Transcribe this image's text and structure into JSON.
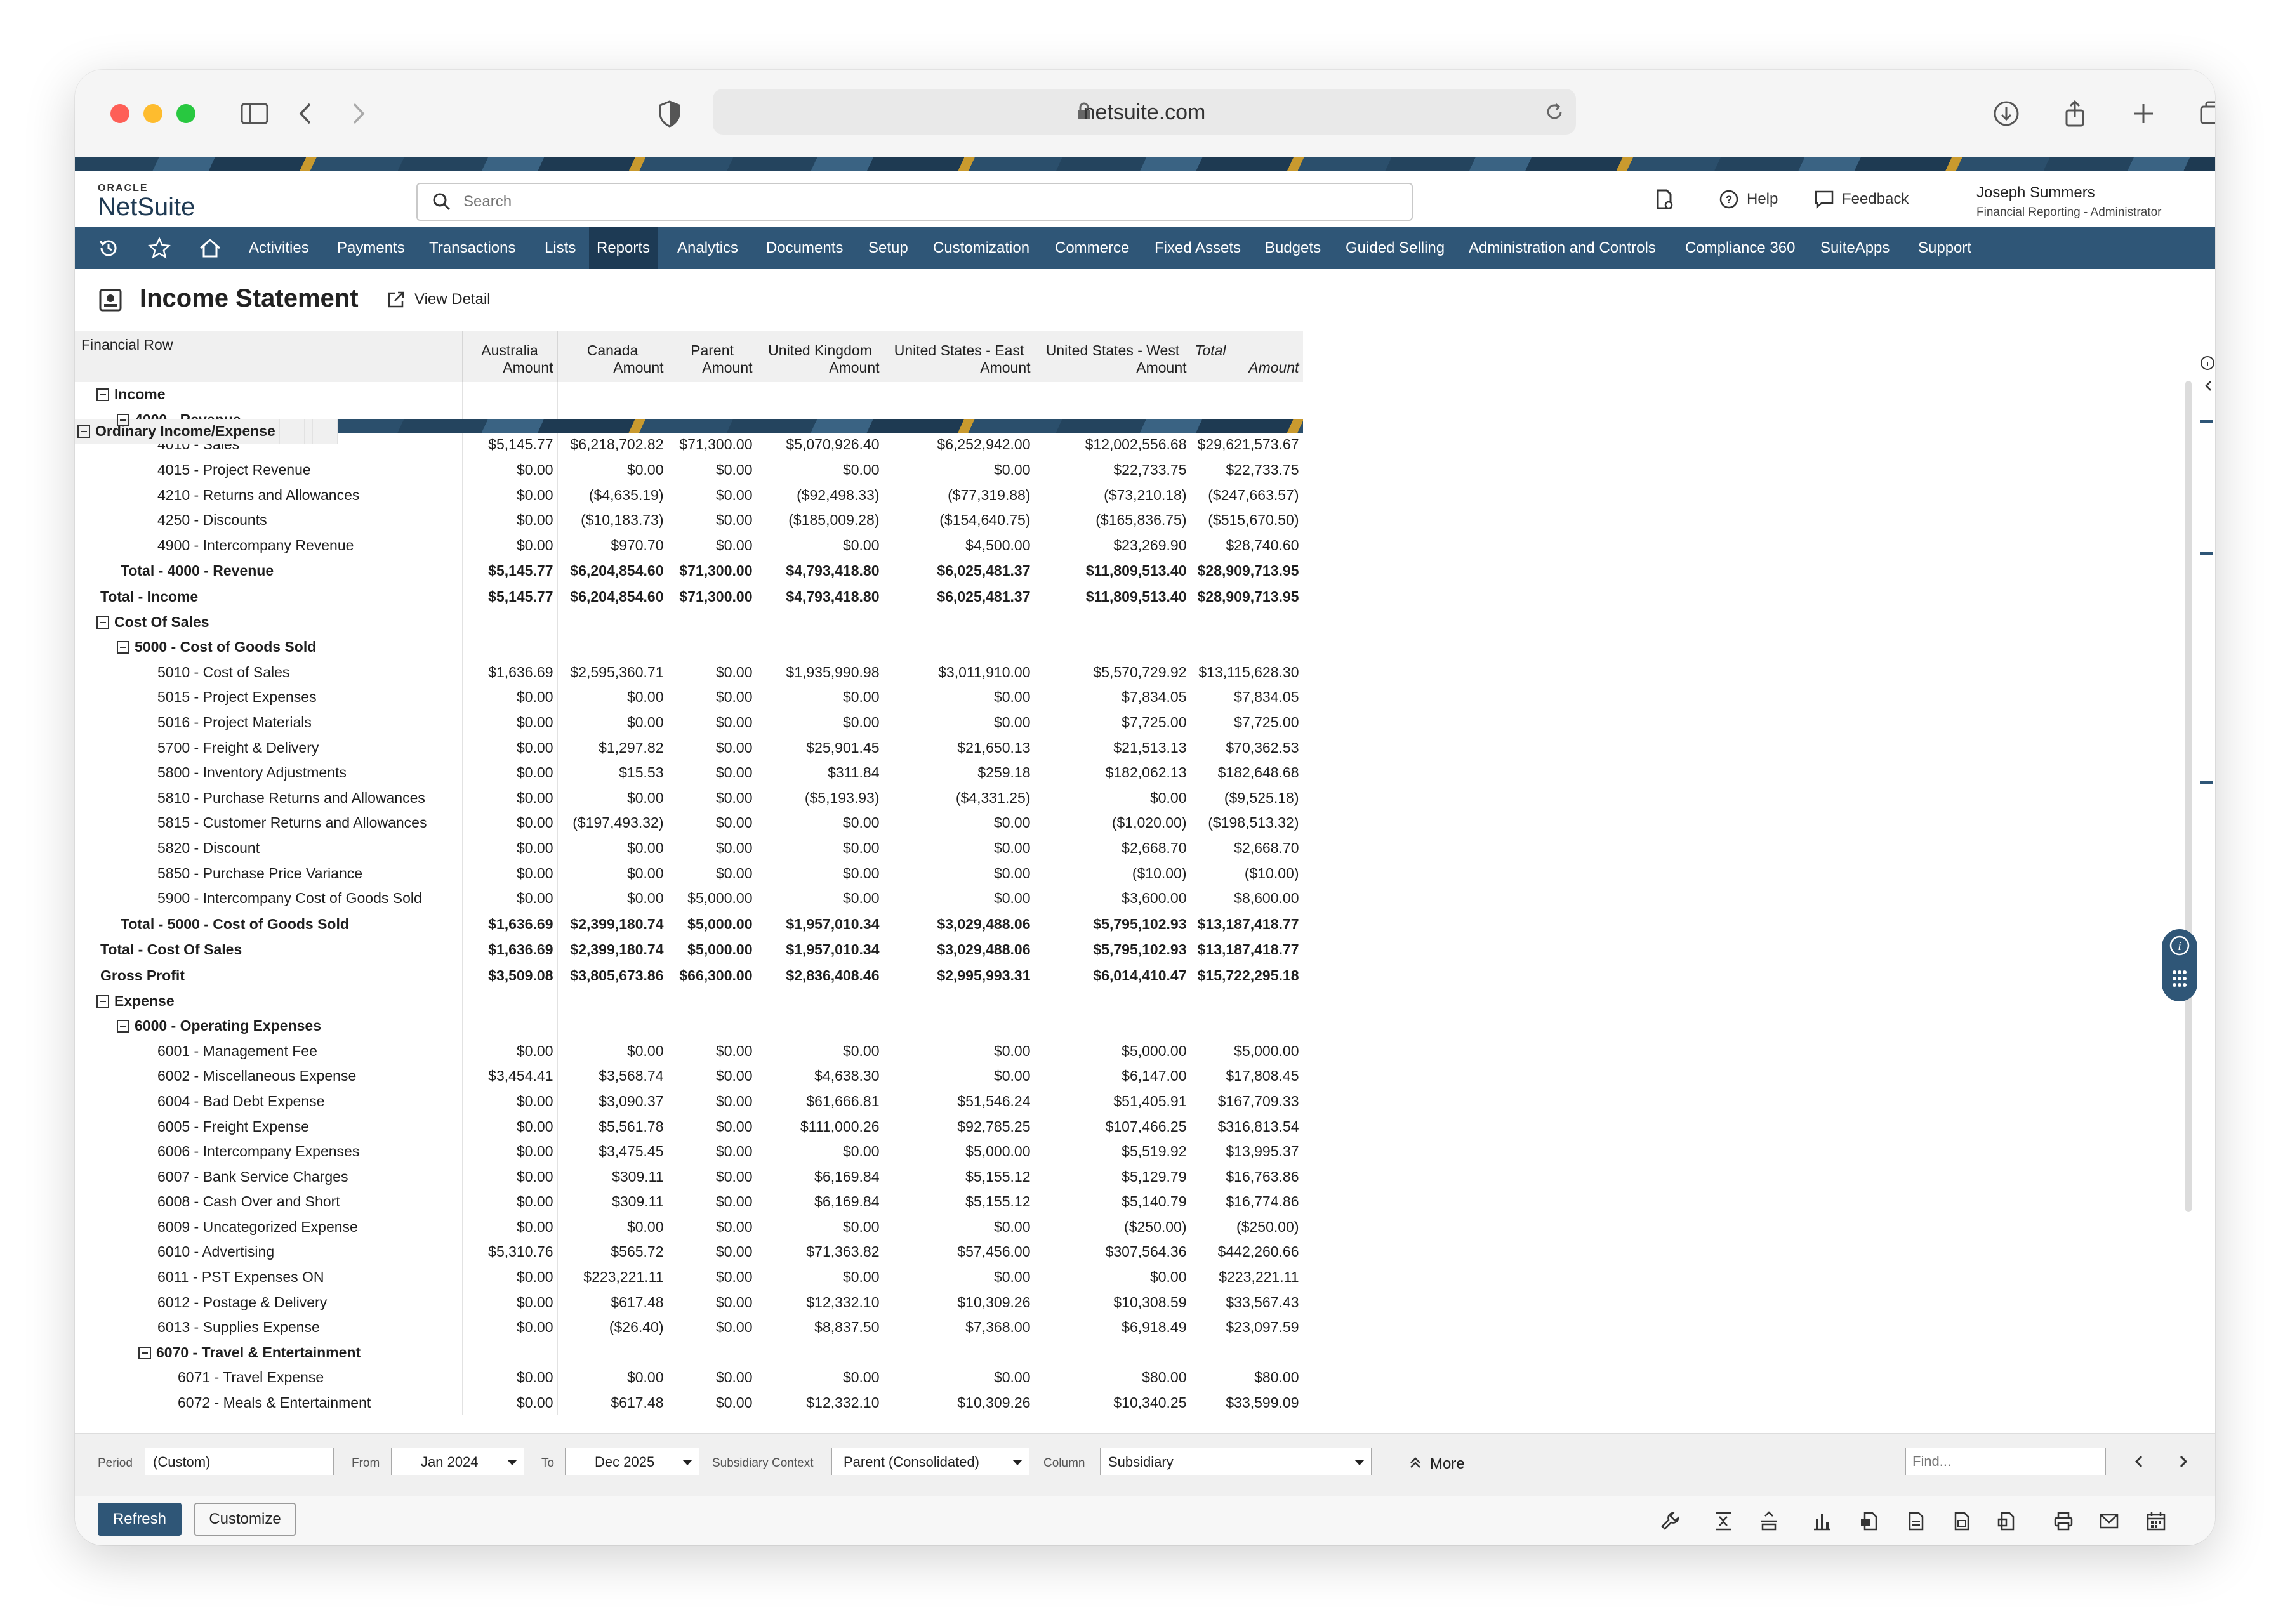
{
  "browser": {
    "url": "netsuite.com"
  },
  "brand": {
    "oracle": "ORACLE",
    "product": "NetSuite"
  },
  "search": {
    "placeholder": "Search"
  },
  "header": {
    "help": "Help",
    "feedback": "Feedback",
    "user_name": "Joseph Summers",
    "user_role": "Financial Reporting - Administrator"
  },
  "nav": {
    "items": [
      "Activities",
      "Payments",
      "Transactions",
      "Lists",
      "Reports",
      "Analytics",
      "Documents",
      "Setup",
      "Customization",
      "Commerce",
      "Fixed Assets",
      "Budgets",
      "Guided Selling",
      "Administration and Controls",
      "Compliance 360",
      "SuiteApps",
      "Support"
    ],
    "active": "Reports"
  },
  "page": {
    "title": "Income Statement",
    "view_detail": "View Detail"
  },
  "report": {
    "row_header": "Financial Row",
    "columns": [
      "Australia",
      "Canada",
      "Parent",
      "United Kingdom",
      "United States - East",
      "United States - West",
      "Total"
    ],
    "sub_header": "Amount",
    "rows": [
      {
        "label": "Ordinary Income/Expense",
        "level": 0,
        "type": "section",
        "values": []
      },
      {
        "label": "Income",
        "level": 1,
        "type": "section",
        "values": []
      },
      {
        "label": "4000 - Revenue",
        "level": 2,
        "type": "section",
        "values": []
      },
      {
        "label": "4010 - Sales",
        "level": 3,
        "type": "line",
        "values": [
          "$5,145.77",
          "$6,218,702.82",
          "$71,300.00",
          "$5,070,926.40",
          "$6,252,942.00",
          "$12,002,556.68",
          "$29,621,573.67"
        ]
      },
      {
        "label": "4015 - Project Revenue",
        "level": 3,
        "type": "line",
        "values": [
          "$0.00",
          "$0.00",
          "$0.00",
          "$0.00",
          "$0.00",
          "$22,733.75",
          "$22,733.75"
        ]
      },
      {
        "label": "4210 - Returns and Allowances",
        "level": 3,
        "type": "line",
        "values": [
          "$0.00",
          "($4,635.19)",
          "$0.00",
          "($92,498.33)",
          "($77,319.88)",
          "($73,210.18)",
          "($247,663.57)"
        ]
      },
      {
        "label": "4250 - Discounts",
        "level": 3,
        "type": "line",
        "values": [
          "$0.00",
          "($10,183.73)",
          "$0.00",
          "($185,009.28)",
          "($154,640.75)",
          "($165,836.75)",
          "($515,670.50)"
        ]
      },
      {
        "label": "4900 - Intercompany Revenue",
        "level": 3,
        "type": "line",
        "values": [
          "$0.00",
          "$970.70",
          "$0.00",
          "$0.00",
          "$4,500.00",
          "$23,269.90",
          "$28,740.60"
        ]
      },
      {
        "label": "Total - 4000 - Revenue",
        "level": 2,
        "type": "total",
        "values": [
          "$5,145.77",
          "$6,204,854.60",
          "$71,300.00",
          "$4,793,418.80",
          "$6,025,481.37",
          "$11,809,513.40",
          "$28,909,713.95"
        ]
      },
      {
        "label": "Total - Income",
        "level": 1,
        "type": "total",
        "values": [
          "$5,145.77",
          "$6,204,854.60",
          "$71,300.00",
          "$4,793,418.80",
          "$6,025,481.37",
          "$11,809,513.40",
          "$28,909,713.95"
        ]
      },
      {
        "label": "Cost Of Sales",
        "level": 1,
        "type": "section",
        "values": []
      },
      {
        "label": "5000 - Cost of Goods Sold",
        "level": 2,
        "type": "section",
        "values": []
      },
      {
        "label": "5010 - Cost of Sales",
        "level": 3,
        "type": "line",
        "values": [
          "$1,636.69",
          "$2,595,360.71",
          "$0.00",
          "$1,935,990.98",
          "$3,011,910.00",
          "$5,570,729.92",
          "$13,115,628.30"
        ]
      },
      {
        "label": "5015 - Project Expenses",
        "level": 3,
        "type": "line",
        "values": [
          "$0.00",
          "$0.00",
          "$0.00",
          "$0.00",
          "$0.00",
          "$7,834.05",
          "$7,834.05"
        ]
      },
      {
        "label": "5016 - Project Materials",
        "level": 3,
        "type": "line",
        "values": [
          "$0.00",
          "$0.00",
          "$0.00",
          "$0.00",
          "$0.00",
          "$7,725.00",
          "$7,725.00"
        ]
      },
      {
        "label": "5700 - Freight & Delivery",
        "level": 3,
        "type": "line",
        "values": [
          "$0.00",
          "$1,297.82",
          "$0.00",
          "$25,901.45",
          "$21,650.13",
          "$21,513.13",
          "$70,362.53"
        ]
      },
      {
        "label": "5800 - Inventory Adjustments",
        "level": 3,
        "type": "line",
        "values": [
          "$0.00",
          "$15.53",
          "$0.00",
          "$311.84",
          "$259.18",
          "$182,062.13",
          "$182,648.68"
        ]
      },
      {
        "label": "5810 - Purchase Returns and Allowances",
        "level": 3,
        "type": "line",
        "values": [
          "$0.00",
          "$0.00",
          "$0.00",
          "($5,193.93)",
          "($4,331.25)",
          "$0.00",
          "($9,525.18)"
        ]
      },
      {
        "label": "5815 - Customer Returns and Allowances",
        "level": 3,
        "type": "line",
        "values": [
          "$0.00",
          "($197,493.32)",
          "$0.00",
          "$0.00",
          "$0.00",
          "($1,020.00)",
          "($198,513.32)"
        ]
      },
      {
        "label": "5820 - Discount",
        "level": 3,
        "type": "line",
        "values": [
          "$0.00",
          "$0.00",
          "$0.00",
          "$0.00",
          "$0.00",
          "$2,668.70",
          "$2,668.70"
        ]
      },
      {
        "label": "5850 - Purchase Price Variance",
        "level": 3,
        "type": "line",
        "values": [
          "$0.00",
          "$0.00",
          "$0.00",
          "$0.00",
          "$0.00",
          "($10.00)",
          "($10.00)"
        ]
      },
      {
        "label": "5900 - Intercompany Cost of Goods Sold",
        "level": 3,
        "type": "line",
        "values": [
          "$0.00",
          "$0.00",
          "$5,000.00",
          "$0.00",
          "$0.00",
          "$3,600.00",
          "$8,600.00"
        ]
      },
      {
        "label": "Total - 5000 - Cost of Goods Sold",
        "level": 2,
        "type": "total",
        "values": [
          "$1,636.69",
          "$2,399,180.74",
          "$5,000.00",
          "$1,957,010.34",
          "$3,029,488.06",
          "$5,795,102.93",
          "$13,187,418.77"
        ]
      },
      {
        "label": "Total - Cost Of Sales",
        "level": 1,
        "type": "total",
        "values": [
          "$1,636.69",
          "$2,399,180.74",
          "$5,000.00",
          "$1,957,010.34",
          "$3,029,488.06",
          "$5,795,102.93",
          "$13,187,418.77"
        ]
      },
      {
        "label": "Gross Profit",
        "level": 1,
        "type": "total",
        "values": [
          "$3,509.08",
          "$3,805,673.86",
          "$66,300.00",
          "$2,836,408.46",
          "$2,995,993.31",
          "$6,014,410.47",
          "$15,722,295.18"
        ]
      },
      {
        "label": "Expense",
        "level": 1,
        "type": "section",
        "values": []
      },
      {
        "label": "6000 - Operating Expenses",
        "level": 2,
        "type": "section",
        "values": []
      },
      {
        "label": "6001 - Management Fee",
        "level": 3,
        "type": "line",
        "values": [
          "$0.00",
          "$0.00",
          "$0.00",
          "$0.00",
          "$0.00",
          "$5,000.00",
          "$5,000.00"
        ]
      },
      {
        "label": "6002 - Miscellaneous Expense",
        "level": 3,
        "type": "line",
        "values": [
          "$3,454.41",
          "$3,568.74",
          "$0.00",
          "$4,638.30",
          "$0.00",
          "$6,147.00",
          "$17,808.45"
        ]
      },
      {
        "label": "6004 - Bad Debt Expense",
        "level": 3,
        "type": "line",
        "values": [
          "$0.00",
          "$3,090.37",
          "$0.00",
          "$61,666.81",
          "$51,546.24",
          "$51,405.91",
          "$167,709.33"
        ]
      },
      {
        "label": "6005 - Freight Expense",
        "level": 3,
        "type": "line",
        "values": [
          "$0.00",
          "$5,561.78",
          "$0.00",
          "$111,000.26",
          "$92,785.25",
          "$107,466.25",
          "$316,813.54"
        ]
      },
      {
        "label": "6006 - Intercompany Expenses",
        "level": 3,
        "type": "line",
        "values": [
          "$0.00",
          "$3,475.45",
          "$0.00",
          "$0.00",
          "$5,000.00",
          "$5,519.92",
          "$13,995.37"
        ]
      },
      {
        "label": "6007 - Bank Service Charges",
        "level": 3,
        "type": "line",
        "values": [
          "$0.00",
          "$309.11",
          "$0.00",
          "$6,169.84",
          "$5,155.12",
          "$5,129.79",
          "$16,763.86"
        ]
      },
      {
        "label": "6008 - Cash Over and Short",
        "level": 3,
        "type": "line",
        "values": [
          "$0.00",
          "$309.11",
          "$0.00",
          "$6,169.84",
          "$5,155.12",
          "$5,140.79",
          "$16,774.86"
        ]
      },
      {
        "label": "6009 - Uncategorized Expense",
        "level": 3,
        "type": "line",
        "values": [
          "$0.00",
          "$0.00",
          "$0.00",
          "$0.00",
          "$0.00",
          "($250.00)",
          "($250.00)"
        ]
      },
      {
        "label": "6010 - Advertising",
        "level": 3,
        "type": "line",
        "values": [
          "$5,310.76",
          "$565.72",
          "$0.00",
          "$71,363.82",
          "$57,456.00",
          "$307,564.36",
          "$442,260.66"
        ]
      },
      {
        "label": "6011 - PST Expenses ON",
        "level": 3,
        "type": "line",
        "values": [
          "$0.00",
          "$223,221.11",
          "$0.00",
          "$0.00",
          "$0.00",
          "$0.00",
          "$223,221.11"
        ]
      },
      {
        "label": "6012 - Postage & Delivery",
        "level": 3,
        "type": "line",
        "values": [
          "$0.00",
          "$617.48",
          "$0.00",
          "$12,332.10",
          "$10,309.26",
          "$10,308.59",
          "$33,567.43"
        ]
      },
      {
        "label": "6013 - Supplies Expense",
        "level": 3,
        "type": "line",
        "values": [
          "$0.00",
          "($26.40)",
          "$0.00",
          "$8,837.50",
          "$7,368.00",
          "$6,918.49",
          "$23,097.59"
        ]
      },
      {
        "label": "6070 - Travel & Entertainment",
        "level": 3,
        "type": "section",
        "values": []
      },
      {
        "label": "6071 - Travel Expense",
        "level": 4,
        "type": "line",
        "values": [
          "$0.00",
          "$0.00",
          "$0.00",
          "$0.00",
          "$0.00",
          "$80.00",
          "$80.00"
        ]
      },
      {
        "label": "6072 - Meals & Entertainment",
        "level": 4,
        "type": "line",
        "values": [
          "$0.00",
          "$617.48",
          "$0.00",
          "$12,332.10",
          "$10,309.26",
          "$10,340.25",
          "$33,599.09"
        ]
      }
    ]
  },
  "filters": {
    "period_label": "Period",
    "period_value": "(Custom)",
    "from_label": "From",
    "from_value": "Jan 2024",
    "to_label": "To",
    "to_value": "Dec 2025",
    "subsidiary_label": "Subsidiary Context",
    "subsidiary_value": "Parent (Consolidated)",
    "column_label": "Column",
    "column_value": "Subsidiary",
    "more": "More",
    "find_placeholder": "Find..."
  },
  "actions": {
    "refresh": "Refresh",
    "customize": "Customize"
  }
}
